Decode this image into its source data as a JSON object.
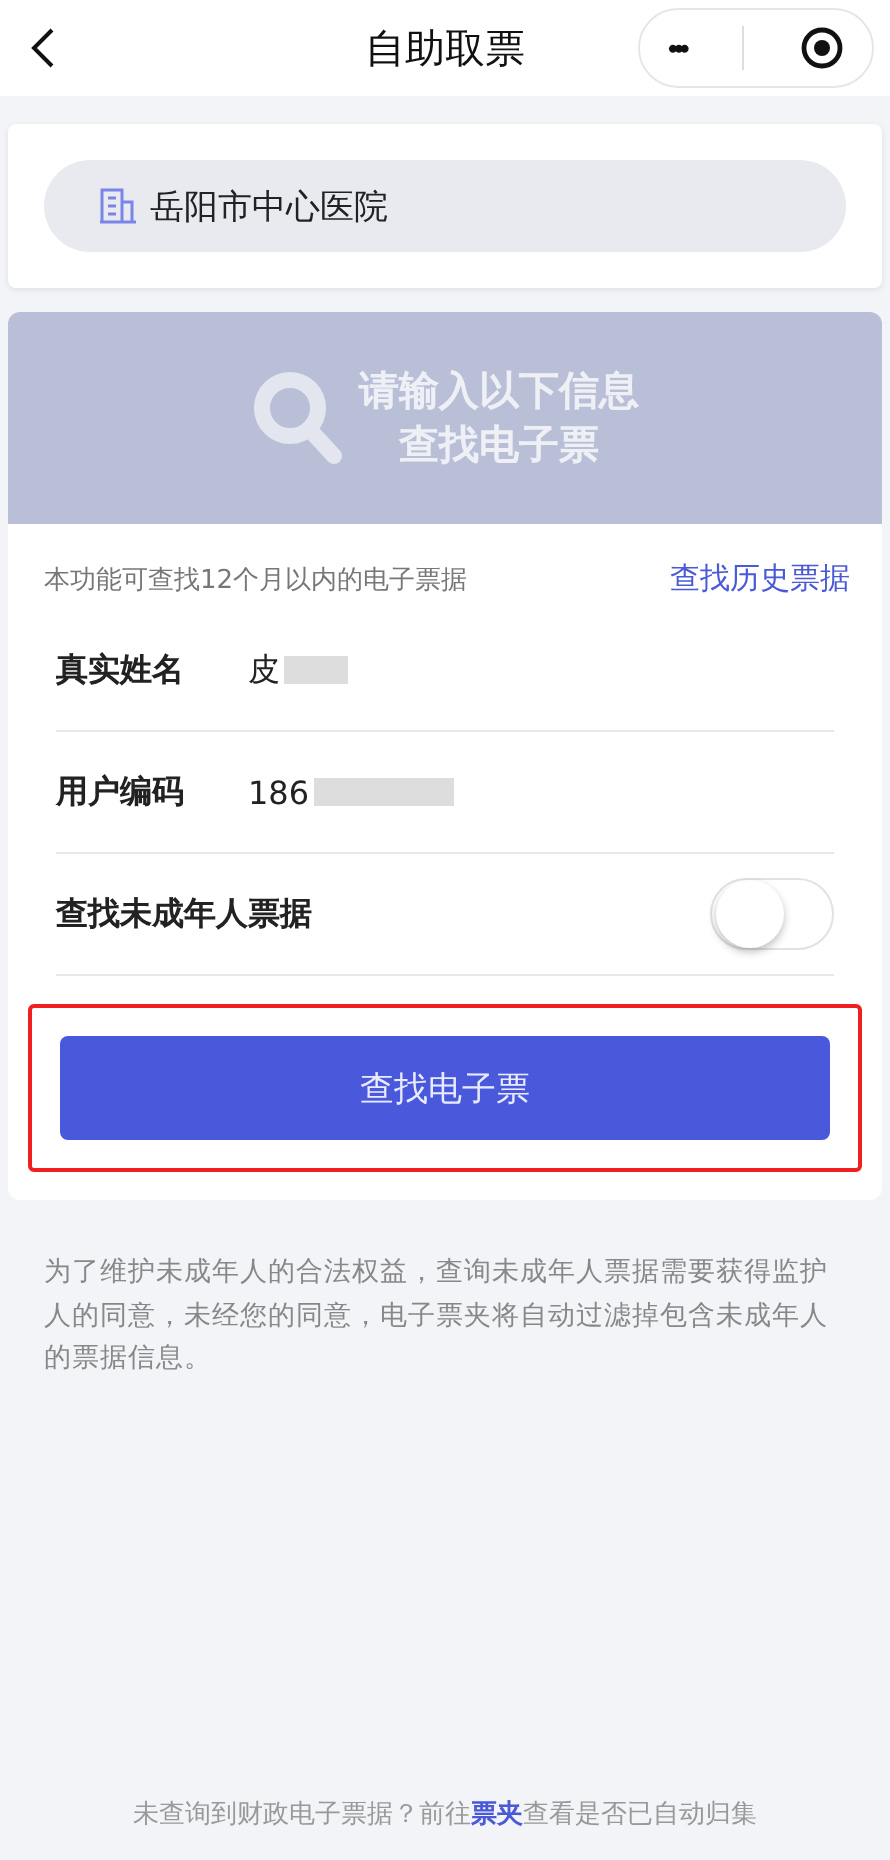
{
  "nav": {
    "title": "自助取票",
    "more": "•••"
  },
  "hospital": {
    "name": "岳阳市中心医院"
  },
  "banner": {
    "line1": "请输入以下信息",
    "line2": "查找电子票"
  },
  "note": {
    "text": "本功能可查找12个月以内的电子票据",
    "link": "查找历史票据"
  },
  "fields": [
    {
      "kind": "text",
      "label": "真实姓名",
      "value": "皮",
      "redacted": true
    },
    {
      "kind": "text",
      "label": "用户编码",
      "value": "186",
      "redacted": true
    },
    {
      "kind": "toggle",
      "label": "查找未成年人票据",
      "on": false
    }
  ],
  "search_button": {
    "label": "查找电子票",
    "highlighted": true
  },
  "disclaimer": "为了维护未成年人的合法权益，查询未成年人票据需要获得监护人的同意，未经您的同意，电子票夹将自动过滤掉包含未成年人的票据信息。",
  "footer": {
    "before": "未查询到财政电子票据？前往",
    "link": "票夹",
    "after": "查看是否已自动归集"
  }
}
